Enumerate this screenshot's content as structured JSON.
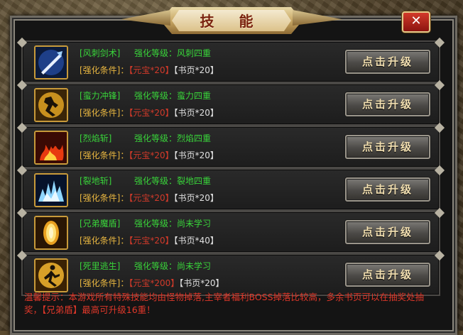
{
  "window": {
    "title": "技 能",
    "close_label": "✕"
  },
  "skills": [
    {
      "name": "[风刺剑术]",
      "level_label": "强化等级：",
      "level_value": "风刺四重",
      "cond_label": "[强化条件]：",
      "yuanbao": "【元宝*20】",
      "page": "【书页*20】",
      "button": "点击升级",
      "icon": "sword-strike-icon"
    },
    {
      "name": "[蛮力冲锋]",
      "level_label": "强化等级：",
      "level_value": "蛮力四重",
      "cond_label": "[强化条件]：",
      "yuanbao": "【元宝*20】",
      "page": "【书页*20】",
      "button": "点击升级",
      "icon": "charge-icon"
    },
    {
      "name": "[烈焰斩]",
      "level_label": "强化等级：",
      "level_value": "烈焰四重",
      "cond_label": "[强化条件]：",
      "yuanbao": "【元宝*20】",
      "page": "【书页*20】",
      "button": "点击升级",
      "icon": "flame-slash-icon"
    },
    {
      "name": "[裂地斩]",
      "level_label": "强化等级：",
      "level_value": "裂地四重",
      "cond_label": "[强化条件]：",
      "yuanbao": "【元宝*20】",
      "page": "【书页*20】",
      "button": "点击升级",
      "icon": "ground-split-icon"
    },
    {
      "name": "[兄弟魔盾]",
      "level_label": "强化等级：",
      "level_value": "尚未学习",
      "cond_label": "[强化条件]：",
      "yuanbao": "【元宝*20】",
      "page": "【书页*40】",
      "button": "点击升级",
      "icon": "magic-shield-icon"
    },
    {
      "name": "[死里逃生]",
      "level_label": "强化等级：",
      "level_value": "尚未学习",
      "cond_label": "[强化条件]：",
      "yuanbao": "【元宝*200】",
      "page": "【书页*20】",
      "button": "点击升级",
      "icon": "escape-icon"
    }
  ],
  "notice": {
    "prefix": "温馨提示：本游戏所有特殊技能均由怪物掉落,主宰者福利BOSS掉落比较高，多余书页可以在抽奖处抽奖，",
    "highlight": "【兄弟盾】",
    "suffix": "最高可升级16重！"
  },
  "colors": {
    "green_text": "#39d43a",
    "gold_text": "#e8b640",
    "red_text": "#d23a2a"
  }
}
